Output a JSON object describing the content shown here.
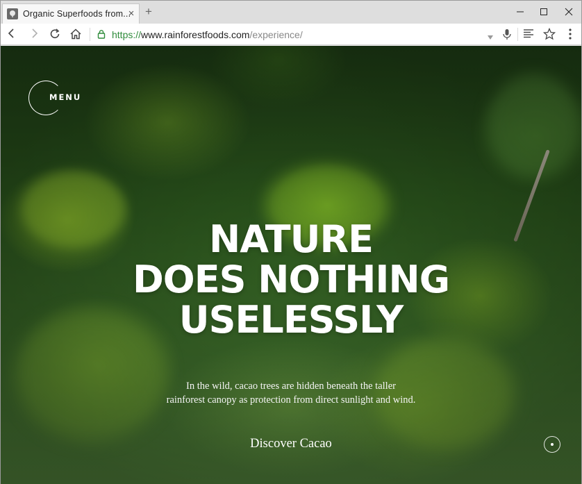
{
  "browser": {
    "tab": {
      "title": "Organic  Superfoods  from...",
      "favicon": "tree-favicon",
      "close": "×"
    },
    "new_tab": "+",
    "window_controls": {
      "minimize": "—",
      "maximize": "☐",
      "close": "✕"
    },
    "url": {
      "scheme": "https://",
      "host": "www.rainforestfoods.com",
      "path": "/experience/"
    },
    "icons": [
      "back-icon",
      "forward-icon",
      "reload-icon",
      "home-icon",
      "lock-icon",
      "dropdown-icon",
      "microphone-icon",
      "reader-mode-icon",
      "bookmark-star-icon",
      "more-icon"
    ],
    "colors": {
      "secure_green": "#2e8b3a",
      "tab_bg": "#f7f7f7",
      "strip_bg": "#dedede"
    }
  },
  "page": {
    "menu_label": "MENU",
    "headline": [
      "NATURE",
      "DOES NOTHING",
      "USELESSLY"
    ],
    "subtext": [
      "In the wild, cacao trees are hidden beneath the taller",
      "rainforest canopy as protection from direct sunlight and wind."
    ],
    "cta": "Discover Cacao",
    "colors": {
      "text": "#ffffff",
      "forest_dark": "#1f3f16",
      "forest_light": "#4d7a38"
    }
  }
}
